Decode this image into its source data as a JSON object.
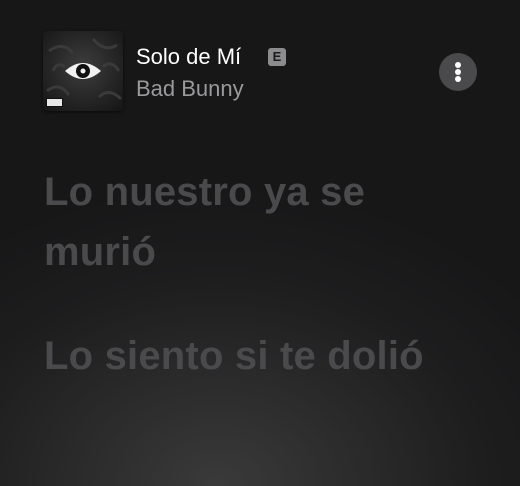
{
  "now_playing": {
    "title": "Solo de Mí",
    "explicit_badge": "E",
    "artist": "Bad Bunny",
    "album_art_icon": "eye-icon",
    "more_icon": "ellipsis-vertical-icon"
  },
  "lyrics": [
    {
      "text": "Lo nuestro ya se murió"
    },
    {
      "text": "Lo siento si te dolió"
    }
  ],
  "colors": {
    "background": "#1d1d1e",
    "lyric_inactive": "#4a4a4c",
    "artist_text": "#9a9a9c",
    "explicit_badge": "#8c8c8e",
    "more_button": "#4a4a4c"
  }
}
